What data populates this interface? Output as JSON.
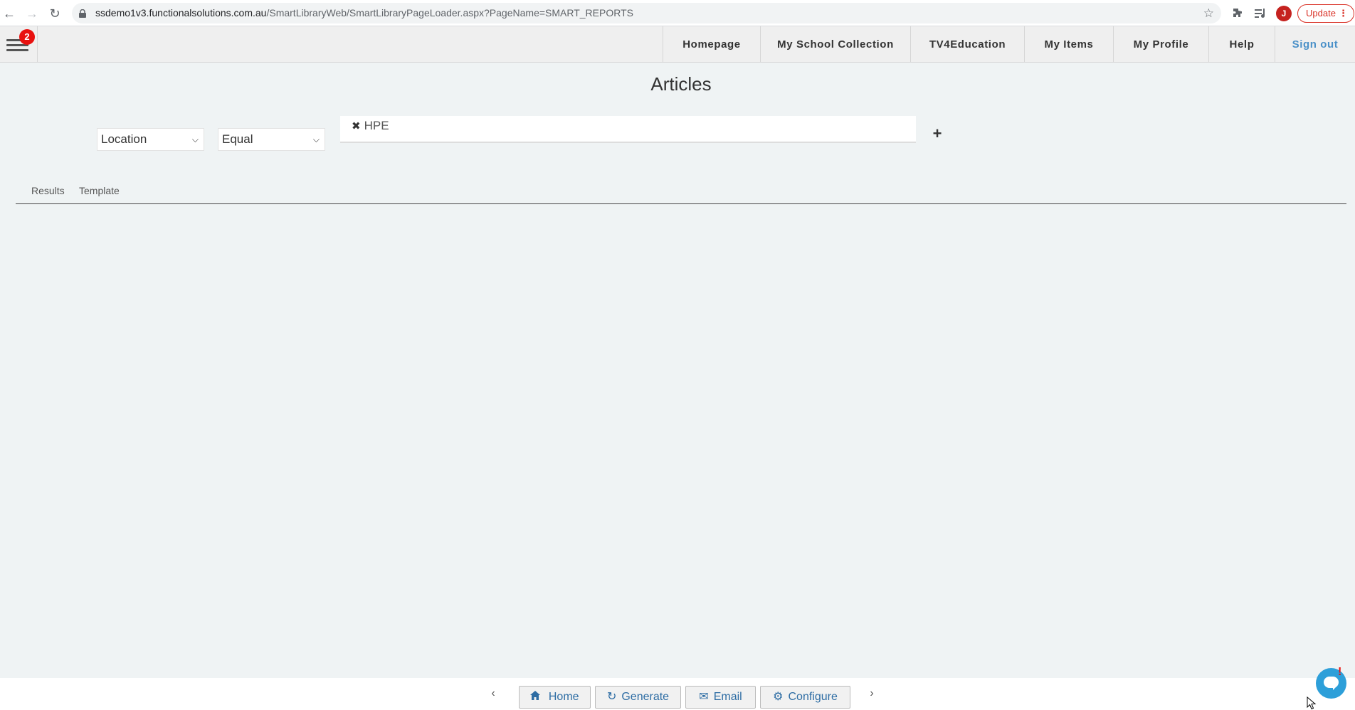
{
  "browser": {
    "url_host": "ssdemo1v3.functionalsolutions.com.au",
    "url_path": "/SmartLibraryWeb/SmartLibraryPageLoader.aspx?PageName=SMART_REPORTS",
    "profile_initial": "J",
    "update_label": "Update"
  },
  "nav": {
    "notification_count": "2",
    "items": [
      {
        "label": "Homepage"
      },
      {
        "label": "My School Collection"
      },
      {
        "label": "TV4Education"
      },
      {
        "label": "My Items"
      },
      {
        "label": "My Profile"
      },
      {
        "label": "Help"
      },
      {
        "label": "Sign out"
      }
    ]
  },
  "page": {
    "title": "Articles"
  },
  "filter": {
    "field": "Location",
    "operator": "Equal",
    "tokens": [
      "HPE"
    ]
  },
  "tabs": [
    {
      "label": "Results"
    },
    {
      "label": "Template"
    }
  ],
  "footer": {
    "buttons": [
      {
        "label": "Home",
        "icon": "home-icon"
      },
      {
        "label": "Generate",
        "icon": "refresh-icon"
      },
      {
        "label": "Email",
        "icon": "envelope-icon"
      },
      {
        "label": "Configure",
        "icon": "cogs-icon"
      }
    ]
  },
  "colors": {
    "accent_link": "#4a90c8",
    "button_text": "#2e6da4",
    "badge": "#e8110f",
    "chat": "#2d9fd9",
    "background": "#eff3f4"
  }
}
